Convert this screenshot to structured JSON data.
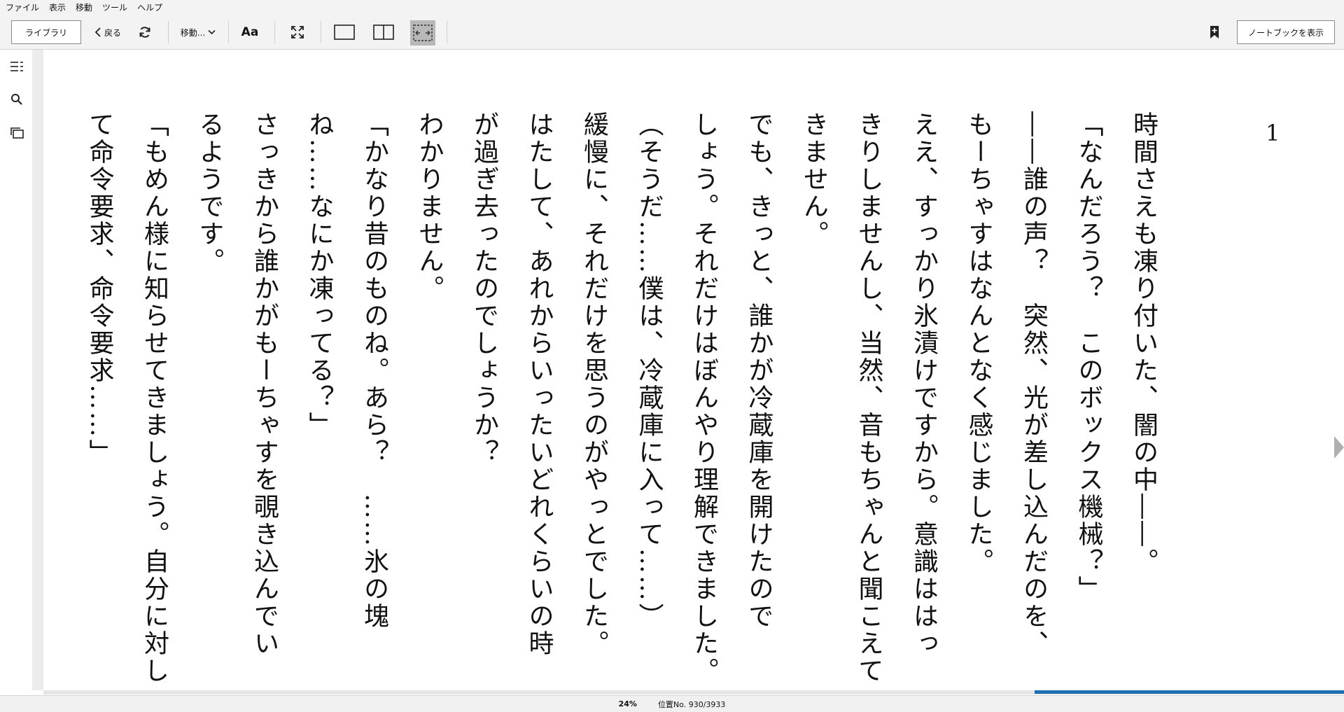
{
  "menubar": {
    "items": [
      "ファイル",
      "表示",
      "移動",
      "ツール",
      "ヘルプ"
    ]
  },
  "toolbar": {
    "library_label": "ライブラリ",
    "back_label": "戻る",
    "goto_label": "移動...",
    "font_label": "Aa",
    "notebook_label": "ノートブックを表示"
  },
  "reader": {
    "page_number": "1",
    "lines": [
      "時間さえも凍り付いた、闇の中――。",
      "「なんだろう？　このボックス機械？」",
      "――誰の声？　突然、光が差し込んだのを、",
      "もーちゃすはなんとなく感じました。",
      "ええ、すっかり氷漬けですから。意識ははっ",
      "きりしませんし、当然、音もちゃんと聞こえて",
      "きません。",
      "でも、きっと、誰かが冷蔵庫を開けたので",
      "しょう。それだけはぼんやり理解できました。",
      "（そうだ……僕は、冷蔵庫に入って……）",
      "緩慢に、それだけを思うのがやっとでした。",
      "はたして、あれからいったいどれくらいの時",
      "が過ぎ去ったのでしょうか？",
      "わかりません。",
      "「かなり昔のものね。あら？　……氷の塊",
      "ね……なにか凍ってる？」",
      "さっきから誰かがもーちゃすを覗き込んでい",
      "るようです。",
      "「もめん様に知らせてきましょう。自分に対し",
      "て命令要求、命令要求……」"
    ]
  },
  "status": {
    "percent": "24%",
    "progress": 0.24,
    "location": "位置No. 930/3933"
  },
  "colors": {
    "progress_fill": "#1f6fb2",
    "chrome_bg": "#f3f3f3"
  },
  "icons": [
    "chevron-left-icon",
    "refresh-icon",
    "chevron-down-icon",
    "fullscreen-icon",
    "single-page-icon",
    "two-page-icon",
    "fit-width-icon",
    "bookmark-add-icon",
    "toc-icon",
    "search-icon",
    "flashcards-icon",
    "next-page-arrow-icon"
  ]
}
